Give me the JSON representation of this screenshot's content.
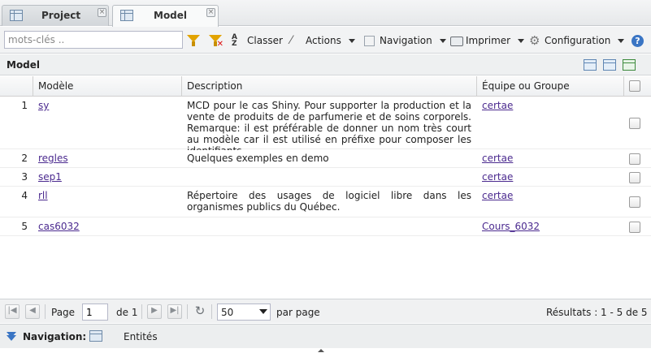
{
  "tabs": [
    {
      "label": "Project",
      "icon": "table-icon",
      "active": false
    },
    {
      "label": "Model",
      "icon": "table-icon",
      "active": true
    }
  ],
  "toolbar": {
    "search_placeholder": "mots-clés ..",
    "sort_label": "Classer",
    "actions_label": "Actions",
    "navigation_label": "Navigation",
    "print_label": "Imprimer",
    "config_label": "Configuration"
  },
  "panel": {
    "title": "Model"
  },
  "grid": {
    "columns": {
      "model": "Modèle",
      "description": "Description",
      "team": "Équipe ou Groupe"
    },
    "rows": [
      {
        "num": "1",
        "model": "sy",
        "description": "MCD pour le cas Shiny. Pour supporter la production et la vente de produits de de parfumerie et de soins corporels. Remarque: il est préférable de donner un nom très court au modèle car il est utilisé en préfixe pour composer les identifiants",
        "team": "certae"
      },
      {
        "num": "2",
        "model": "regles",
        "description": "Quelques exemples en demo",
        "team": "certae"
      },
      {
        "num": "3",
        "model": "sep1",
        "description": "",
        "team": "certae"
      },
      {
        "num": "4",
        "model": "rll",
        "description": "Répertoire des usages de logiciel libre dans les organismes publics du Québec.",
        "team": "certae"
      },
      {
        "num": "5",
        "model": "cas6032",
        "description": "",
        "team": "Cours_6032"
      }
    ]
  },
  "pager": {
    "page_label": "Page",
    "page_value": "1",
    "of_label": "de 1",
    "page_size": "50",
    "per_page_label": "par page",
    "results_label": "Résultats : 1 - 5 de 5"
  },
  "navbar": {
    "label": "Navigation:",
    "link": "Entités"
  },
  "colors": {
    "link": "#4b2a8f",
    "accent": "#3a75c4",
    "filter": "#e2a300"
  }
}
